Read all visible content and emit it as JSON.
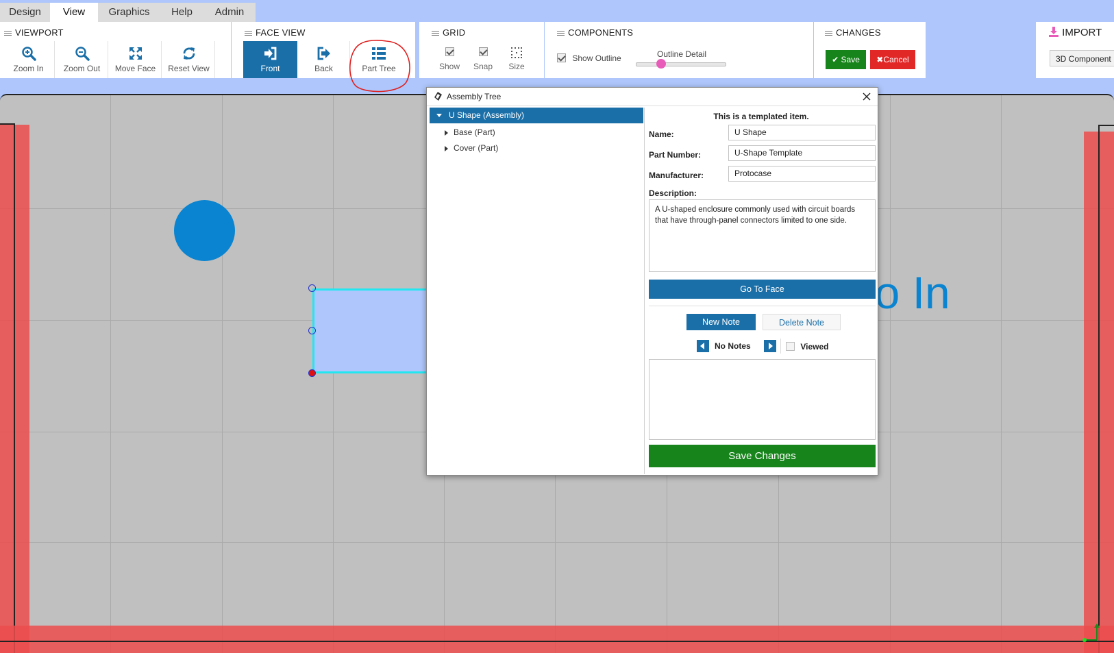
{
  "menu": {
    "tabs": [
      {
        "label": "Design"
      },
      {
        "label": "View"
      },
      {
        "label": "Graphics"
      },
      {
        "label": "Help"
      },
      {
        "label": "Admin"
      }
    ],
    "active_tab": "View"
  },
  "ribbon": {
    "viewport": {
      "title": "VIEWPORT",
      "buttons": [
        {
          "label": "Zoom In",
          "icon": "zoom-in-icon"
        },
        {
          "label": "Zoom Out",
          "icon": "zoom-out-icon"
        },
        {
          "label": "Move Face",
          "icon": "move-icon"
        },
        {
          "label": "Reset View",
          "icon": "refresh-icon"
        }
      ]
    },
    "face_view": {
      "title": "FACE VIEW",
      "buttons": [
        {
          "label": "Front",
          "icon": "sign-in-icon",
          "active": true
        },
        {
          "label": "Back",
          "icon": "sign-out-icon"
        },
        {
          "label": "Part Tree",
          "icon": "list-icon",
          "highlighted": true
        }
      ]
    },
    "grid": {
      "title": "GRID",
      "show": {
        "label": "Show",
        "checked": true
      },
      "snap": {
        "label": "Snap",
        "checked": true
      },
      "size": {
        "label": "Size",
        "icon": "grid-dots-icon"
      }
    },
    "components": {
      "title": "COMPONENTS",
      "show_outline": {
        "label": "Show Outline",
        "checked": true
      },
      "outline_detail": {
        "label": "Outline Detail",
        "value": 0.25
      }
    },
    "changes": {
      "title": "CHANGES",
      "save_label": "Save",
      "cancel_label": "Cancel"
    },
    "import": {
      "title": "IMPORT",
      "component_label": "3D Component"
    }
  },
  "canvas": {
    "partial_text": "io In"
  },
  "dialog": {
    "title": "Assembly Tree",
    "tree": [
      {
        "label": "U Shape (Assembly)",
        "expanded": true,
        "selected": true
      },
      {
        "label": "Base (Part)",
        "expanded": false
      },
      {
        "label": "Cover (Part)",
        "expanded": false
      }
    ],
    "details": {
      "template_notice": "This is a templated item.",
      "name_label": "Name:",
      "name_value": "U Shape",
      "part_number_label": "Part Number:",
      "part_number_value": "U-Shape Template",
      "manufacturer_label": "Manufacturer:",
      "manufacturer_value": "Protocase",
      "description_label": "Description:",
      "description_value": "A U-shaped enclosure commonly used with circuit boards that have through-panel connectors limited to one side.",
      "goto_face_label": "Go To Face",
      "new_note_label": "New Note",
      "delete_note_label": "Delete Note",
      "notes_status": "No Notes",
      "viewed_label": "Viewed",
      "save_changes_label": "Save Changes"
    }
  },
  "colors": {
    "accent_blue": "#1a6fa8",
    "save_green": "#16841a",
    "cancel_red": "#e22727",
    "canvas_gray": "#c0c0c0",
    "wall_red": "#e05555",
    "selection_cyan": "#22e6f0",
    "circle_blue": "#0a84d0"
  }
}
